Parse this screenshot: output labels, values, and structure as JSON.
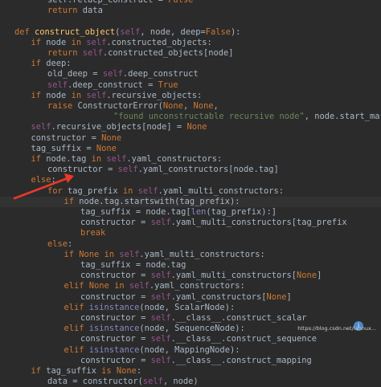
{
  "code_lines": [
    {
      "indent": 2,
      "tokens": [
        [
          "pl",
          "self.retacp_construct "
        ],
        [
          "pl",
          "= "
        ],
        [
          "k",
          "False"
        ]
      ]
    },
    {
      "indent": 2,
      "tokens": [
        [
          "k",
          "return "
        ],
        [
          "pl",
          "data"
        ]
      ]
    },
    {
      "indent": 0,
      "tokens": [
        [
          "pl",
          ""
        ]
      ]
    },
    {
      "indent": 0,
      "tokens": [
        [
          "k",
          "def "
        ],
        [
          "fn",
          "construct_object"
        ],
        [
          "pl",
          "("
        ],
        [
          "sf",
          "self"
        ],
        [
          "pl",
          ", node, deep="
        ],
        [
          "k",
          "False"
        ],
        [
          "pl",
          "):"
        ]
      ]
    },
    {
      "indent": 1,
      "tokens": [
        [
          "k",
          "if "
        ],
        [
          "pl",
          "node "
        ],
        [
          "k",
          "in "
        ],
        [
          "sf",
          "self"
        ],
        [
          "pl",
          ".constructed_objects:"
        ]
      ]
    },
    {
      "indent": 2,
      "tokens": [
        [
          "k",
          "return "
        ],
        [
          "sf",
          "self"
        ],
        [
          "pl",
          ".constructed_objects[node]"
        ]
      ]
    },
    {
      "indent": 1,
      "tokens": [
        [
          "k",
          "if "
        ],
        [
          "pl",
          "deep:"
        ]
      ]
    },
    {
      "indent": 2,
      "tokens": [
        [
          "pl",
          "old_deep = "
        ],
        [
          "sf",
          "self"
        ],
        [
          "pl",
          ".deep_construct"
        ]
      ]
    },
    {
      "indent": 2,
      "tokens": [
        [
          "sf",
          "self"
        ],
        [
          "pl",
          ".deep_construct = "
        ],
        [
          "k",
          "True"
        ]
      ]
    },
    {
      "indent": 1,
      "tokens": [
        [
          "k",
          "if "
        ],
        [
          "pl",
          "node "
        ],
        [
          "k",
          "in "
        ],
        [
          "sf",
          "self"
        ],
        [
          "pl",
          ".recursive_objects:"
        ]
      ]
    },
    {
      "indent": 2,
      "tokens": [
        [
          "k",
          "raise "
        ],
        [
          "pl",
          "ConstructorError("
        ],
        [
          "k",
          "None"
        ],
        [
          "pl",
          ", "
        ],
        [
          "k",
          "None"
        ],
        [
          "pl",
          ","
        ]
      ]
    },
    {
      "indent": 6,
      "tokens": [
        [
          "s",
          "\"found unconstructable recursive node\""
        ],
        [
          "pl",
          ", node.start_mark)"
        ]
      ]
    },
    {
      "indent": 1,
      "tokens": [
        [
          "sf",
          "self"
        ],
        [
          "pl",
          ".recursive_objects[node] = "
        ],
        [
          "k",
          "None"
        ]
      ]
    },
    {
      "indent": 1,
      "tokens": [
        [
          "pl",
          "constructor = "
        ],
        [
          "k",
          "None"
        ]
      ]
    },
    {
      "indent": 1,
      "tokens": [
        [
          "pl",
          "tag_suffix = "
        ],
        [
          "k",
          "None"
        ]
      ]
    },
    {
      "indent": 1,
      "tokens": [
        [
          "k",
          "if "
        ],
        [
          "pl",
          "node.tag "
        ],
        [
          "k",
          "in "
        ],
        [
          "sf",
          "self"
        ],
        [
          "pl",
          ".yaml_constructors:"
        ]
      ]
    },
    {
      "indent": 2,
      "tokens": [
        [
          "pl",
          "constructor = "
        ],
        [
          "sf",
          "self"
        ],
        [
          "pl",
          ".yaml_constructors[node.tag]"
        ]
      ]
    },
    {
      "indent": 1,
      "tokens": [
        [
          "k",
          "else"
        ],
        [
          "pl",
          ":"
        ]
      ]
    },
    {
      "indent": 2,
      "tokens": [
        [
          "k",
          "for "
        ],
        [
          "pl",
          "tag_prefix "
        ],
        [
          "k",
          "in "
        ],
        [
          "sf",
          "self"
        ],
        [
          "pl",
          ".yaml_multi_constructors:"
        ]
      ]
    },
    {
      "indent": 3,
      "hl": true,
      "tokens": [
        [
          "k",
          "if "
        ],
        [
          "pl",
          "node.tag.startswith(tag_prefix):"
        ]
      ]
    },
    {
      "indent": 4,
      "tokens": [
        [
          "pl",
          "tag_suffix = node.tag["
        ],
        [
          "n",
          "len"
        ],
        [
          "pl",
          "(tag_prefix):]"
        ]
      ]
    },
    {
      "indent": 4,
      "tokens": [
        [
          "pl",
          "constructor = "
        ],
        [
          "sf",
          "self"
        ],
        [
          "pl",
          ".yaml_multi_constructors[tag_prefix"
        ]
      ]
    },
    {
      "indent": 4,
      "tokens": [
        [
          "k",
          "break"
        ]
      ]
    },
    {
      "indent": 2,
      "tokens": [
        [
          "k",
          "else"
        ],
        [
          "pl",
          ":"
        ]
      ]
    },
    {
      "indent": 3,
      "tokens": [
        [
          "k",
          "if "
        ],
        [
          "k",
          "None "
        ],
        [
          "k",
          "in "
        ],
        [
          "sf",
          "self"
        ],
        [
          "pl",
          ".yaml_multi_constructors:"
        ]
      ]
    },
    {
      "indent": 4,
      "tokens": [
        [
          "pl",
          "tag_suffix = node.tag"
        ]
      ]
    },
    {
      "indent": 4,
      "tokens": [
        [
          "pl",
          "constructor = "
        ],
        [
          "sf",
          "self"
        ],
        [
          "pl",
          ".yaml_multi_constructors["
        ],
        [
          "k",
          "None"
        ],
        [
          "pl",
          "]"
        ]
      ]
    },
    {
      "indent": 3,
      "tokens": [
        [
          "k",
          "elif "
        ],
        [
          "k",
          "None "
        ],
        [
          "k",
          "in "
        ],
        [
          "sf",
          "self"
        ],
        [
          "pl",
          ".yaml_constructors:"
        ]
      ]
    },
    {
      "indent": 4,
      "tokens": [
        [
          "pl",
          "constructor = "
        ],
        [
          "sf",
          "self"
        ],
        [
          "pl",
          ".yaml_constructors["
        ],
        [
          "k",
          "None"
        ],
        [
          "pl",
          "]"
        ]
      ]
    },
    {
      "indent": 3,
      "tokens": [
        [
          "k",
          "elif "
        ],
        [
          "n",
          "isinstance"
        ],
        [
          "pl",
          "(node, ScalarNode):"
        ]
      ]
    },
    {
      "indent": 4,
      "tokens": [
        [
          "pl",
          "constructor = "
        ],
        [
          "sf",
          "self"
        ],
        [
          "pl",
          ".__class__.construct_scalar"
        ]
      ]
    },
    {
      "indent": 3,
      "tokens": [
        [
          "k",
          "elif "
        ],
        [
          "n",
          "isinstance"
        ],
        [
          "pl",
          "(node, SequenceNode):"
        ]
      ]
    },
    {
      "indent": 4,
      "tokens": [
        [
          "pl",
          "constructor = "
        ],
        [
          "sf",
          "self"
        ],
        [
          "pl",
          ".__class__.construct_sequence"
        ]
      ]
    },
    {
      "indent": 3,
      "tokens": [
        [
          "k",
          "elif "
        ],
        [
          "n",
          "isinstance"
        ],
        [
          "pl",
          "(node, MappingNode):"
        ]
      ]
    },
    {
      "indent": 4,
      "tokens": [
        [
          "pl",
          "constructor = "
        ],
        [
          "sf",
          "self"
        ],
        [
          "pl",
          ".__class__.construct_mapping"
        ]
      ]
    },
    {
      "indent": 1,
      "tokens": [
        [
          "k",
          "if "
        ],
        [
          "pl",
          "tag_suffix "
        ],
        [
          "k",
          "is "
        ],
        [
          "k",
          "None"
        ],
        [
          "pl",
          ":"
        ]
      ]
    },
    {
      "indent": 2,
      "tokens": [
        [
          "pl",
          "data = constructor("
        ],
        [
          "sf",
          "self"
        ],
        [
          "pl",
          ", node)"
        ]
      ]
    }
  ],
  "colors": {
    "background": "#2b2b2b",
    "keyword": "#cc7832",
    "string": "#6a8759",
    "builtin": "#8888c6",
    "self": "#94558d",
    "function": "#ffc66d",
    "plain": "#a9b7c6",
    "arrow": "#e8392b"
  },
  "watermark": "https://blog.csdn.net/lannux..."
}
